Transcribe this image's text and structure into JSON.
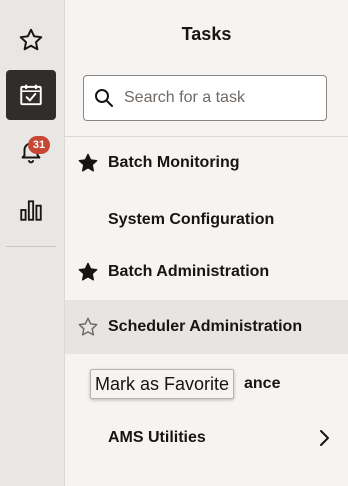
{
  "rail": {
    "items": [
      {
        "icon": "star-outline-icon",
        "active": false
      },
      {
        "icon": "calendar-check-icon",
        "active": true
      },
      {
        "icon": "bell-icon",
        "active": false,
        "badge": "31"
      },
      {
        "icon": "bar-chart-icon",
        "active": false
      }
    ]
  },
  "panel": {
    "title": "Tasks",
    "search_placeholder": "Search for a task",
    "items": [
      {
        "label": "Batch Monitoring",
        "star": "filled"
      },
      {
        "label": "System Configuration",
        "star": "none"
      },
      {
        "label": "Batch Administration",
        "star": "filled"
      },
      {
        "label": "Scheduler Administration",
        "star": "outline",
        "hovered": true
      },
      {
        "label": "ance",
        "star": "none"
      },
      {
        "label": "AMS Utilities",
        "star": "none",
        "has_submenu": true
      }
    ]
  },
  "tooltip": {
    "text": "Mark as Favorite"
  },
  "colors": {
    "rail_bg": "#e9e7e4",
    "active_bg": "#312d2a",
    "badge_bg": "#c74634",
    "panel_bg": "#f5f4f2",
    "hover_bg": "#e7e5e2",
    "text": "#161513"
  }
}
